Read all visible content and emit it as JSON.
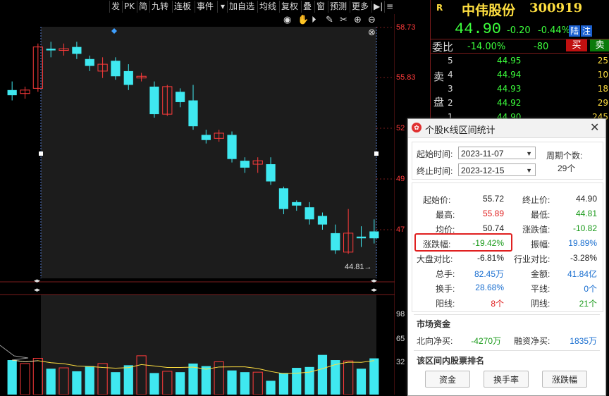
{
  "toolbar": {
    "buttons": [
      "发",
      "PK",
      "简",
      "九转",
      "连板",
      "事件",
      "加自选",
      "均线",
      "复权",
      "叠",
      "窗",
      "预测",
      "更多"
    ]
  },
  "chart": {
    "price_labels": [
      "58.73",
      "55.83",
      "52",
      "49",
      "47"
    ],
    "volume_labels": [
      "98",
      "65",
      "32"
    ],
    "low_marker": "44.81→",
    "colors": {
      "up": "#ff3b3b",
      "down": "#3fe8f0",
      "avg": "#ffdf40"
    }
  },
  "chart_data": {
    "type": "candlestick",
    "candles": [
      [
        55.1,
        54.8,
        55.6,
        54.5
      ],
      [
        54.9,
        55.1,
        55.3,
        54.6
      ],
      [
        55.2,
        57.6,
        57.8,
        55.0
      ],
      [
        57.5,
        57.4,
        57.9,
        57.0
      ],
      [
        57.4,
        57.5,
        57.8,
        57.1
      ],
      [
        57.6,
        57.2,
        57.9,
        56.9
      ],
      [
        56.9,
        56.5,
        57.1,
        56.2
      ],
      [
        56.2,
        56.6,
        57.0,
        55.8
      ],
      [
        56.8,
        55.9,
        57.0,
        55.7
      ],
      [
        56.2,
        55.4,
        56.6,
        55.1
      ],
      [
        55.8,
        55.9,
        56.1,
        55.6
      ],
      [
        55.3,
        53.7,
        55.6,
        53.5
      ],
      [
        53.7,
        55.3,
        55.4,
        53.6
      ],
      [
        55.0,
        54.4,
        55.2,
        54.1
      ],
      [
        54.5,
        53.0,
        55.4,
        52.8
      ],
      [
        52.5,
        52.2,
        52.8,
        52.0
      ],
      [
        52.3,
        52.6,
        52.8,
        52.1
      ],
      [
        52.5,
        51.1,
        52.7,
        50.9
      ],
      [
        51.0,
        50.6,
        51.2,
        50.3
      ],
      [
        50.8,
        51.0,
        51.2,
        50.3
      ],
      [
        50.8,
        49.8,
        51.2,
        49.6
      ],
      [
        49.4,
        48.2,
        49.5,
        47.9
      ],
      [
        48.6,
        48.4,
        48.7,
        48.1
      ],
      [
        48.3,
        47.6,
        48.6,
        47.3
      ],
      [
        47.8,
        47.3,
        48.0,
        47.0
      ],
      [
        46.8,
        45.8,
        47.3,
        45.6
      ],
      [
        45.7,
        46.8,
        48.2,
        45.6
      ],
      [
        46.6,
        46.5,
        47.2,
        46.0
      ],
      [
        46.9,
        46.5,
        47.6,
        46.2
      ]
    ],
    "volumes": [
      40,
      36,
      42,
      30,
      31,
      27,
      33,
      36,
      26,
      34,
      45,
      25,
      27,
      26,
      36,
      33,
      38,
      28,
      26,
      26,
      16,
      25,
      31,
      32,
      46,
      40,
      39,
      30,
      42
    ]
  },
  "quote": {
    "badge": "R",
    "name": "中伟股份",
    "code": "300919",
    "price": "44.90",
    "change": "-0.20",
    "change_pct": "-0.44%",
    "tag1": "陆",
    "tag2": "注",
    "weibi_label": "委比",
    "weibi": "-14.00%",
    "weicha": "-80",
    "buy_btn": "买",
    "sell_btn": "卖",
    "sell_side_label": "卖",
    "sell_side_label2": "盘",
    "asks": [
      {
        "level": "5",
        "price": "44.95",
        "vol": "25"
      },
      {
        "level": "4",
        "price": "44.94",
        "vol": "10"
      },
      {
        "level": "3",
        "price": "44.93",
        "vol": "18"
      },
      {
        "level": "2",
        "price": "44.92",
        "vol": "29"
      },
      {
        "level": "1",
        "price": "44.90",
        "vol": "245"
      }
    ]
  },
  "dialog": {
    "title": "个股K线区间统计",
    "start_label": "起始时间:",
    "start_value": "2023-11-07",
    "end_label": "终止时间:",
    "end_value": "2023-12-15",
    "period_label": "周期个数:",
    "period_value": "29个",
    "stats": {
      "start_price_label": "起始价:",
      "start_price": "55.72",
      "end_price_label": "终止价:",
      "end_price": "44.90",
      "high_label": "最高:",
      "high": "55.89",
      "low_label": "最低:",
      "low": "44.81",
      "avg_label": "均价:",
      "avg": "50.74",
      "chg_label": "涨跌值:",
      "chg": "-10.82",
      "chg_pct_label": "涨跌幅:",
      "chg_pct": "-19.42%",
      "amp_label": "振幅:",
      "amp": "19.89%",
      "market_rel_label": "大盘对比:",
      "market_rel": "-6.81%",
      "industry_rel_label": "行业对比:",
      "industry_rel": "-3.28%",
      "vol_label": "总手:",
      "vol": "82.45万",
      "amount_label": "金额:",
      "amount": "41.84亿",
      "turnover_label": "换手:",
      "turnover": "28.68%",
      "flat_label": "平线:",
      "flat": "0个",
      "up_label": "阳线:",
      "up": "8个",
      "down_label": "阴线:",
      "down": "21个"
    },
    "market_funds_title": "市场资金",
    "north_label": "北向净买:",
    "north": "-4270万",
    "margin_label": "融资净买:",
    "margin": "1835万",
    "rank_title": "该区间内股票排名",
    "rank_buttons": [
      "资金",
      "换手率",
      "涨跌幅"
    ]
  }
}
